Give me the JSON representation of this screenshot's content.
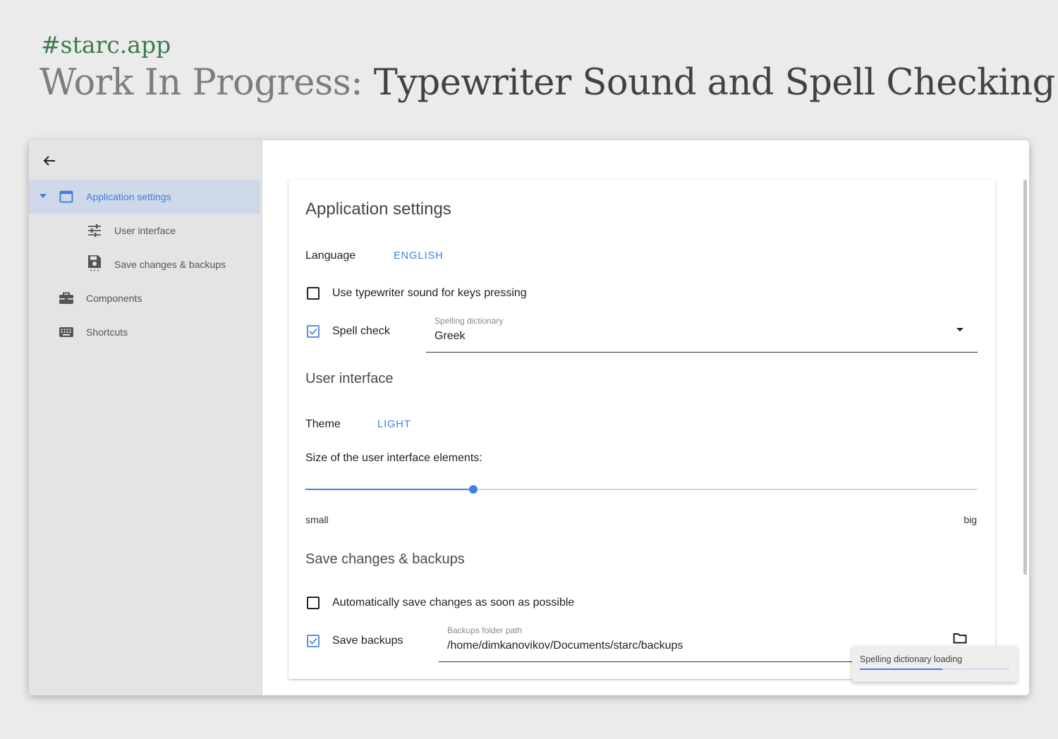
{
  "header": {
    "hashtag": "#starc.app",
    "prefix": "Work In Progress:",
    "title": "Typewriter Sound and Spell Checking"
  },
  "sidebar": {
    "back_icon": "arrow-back-icon",
    "items": [
      {
        "label": "Application settings",
        "icon": "window-icon",
        "active": true,
        "expanded": true
      },
      {
        "label": "User interface",
        "icon": "tune-sliders-icon"
      },
      {
        "label": "Save changes & backups",
        "icon": "floppy-disk-icon"
      },
      {
        "label": "Components",
        "icon": "toolbox-icon"
      },
      {
        "label": "Shortcuts",
        "icon": "keyboard-icon"
      }
    ]
  },
  "card": {
    "title": "Application settings",
    "language_label": "Language",
    "language_value": "ENGLISH",
    "typewriter_label": "Use typewriter sound for keys pressing",
    "typewriter_checked": false,
    "spellcheck_label": "Spell check",
    "spellcheck_checked": true,
    "dictionary_caption": "Spelling dictionary",
    "dictionary_value": "Greek",
    "ui_section": "User interface",
    "theme_label": "Theme",
    "theme_value": "LIGHT",
    "size_label": "Size of the user interface elements:",
    "size_level": 0.25,
    "size_min": "small",
    "size_max": "big",
    "save_section": "Save changes & backups",
    "autosave_label": "Automatically save changes as soon as possible",
    "autosave_checked": false,
    "backups_label": "Save backups",
    "backups_checked": true,
    "backups_caption": "Backups folder path",
    "backups_path": "/home/dimkanovikov/Documents/starc/backups"
  },
  "toast": {
    "text": "Spelling dictionary loading",
    "progress": 0.55
  },
  "colors": {
    "accent": "#3e7fe0",
    "hashtag": "#3f7a51",
    "sidebar_bg": "#e4e4e4",
    "active_bg": "#cfd8e8"
  }
}
